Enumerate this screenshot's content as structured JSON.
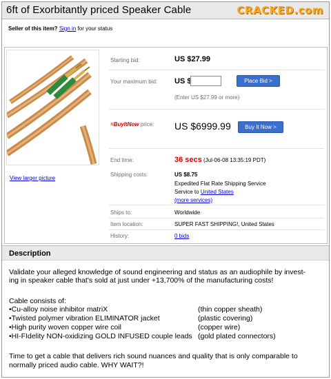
{
  "header": {
    "title": "6ft of Exorbitantly priced Speaker Cable",
    "logo": "CRACKED.com"
  },
  "seller": {
    "question": "Seller of this item?",
    "sign_in": "Sign in",
    "suffix": "for your status"
  },
  "listing": {
    "starting_bid_label": "Starting bid:",
    "starting_bid_value": "US $27.99",
    "max_bid_label": "Your maximum bid:",
    "max_bid_currency": "US $",
    "max_bid_value": "",
    "place_bid_button": "Place Bid >",
    "enter_hint": "(Enter US $27.99 or more)",
    "buy_it_now_logo": "=BuyItNow",
    "buy_it_now_label": "price:",
    "buy_it_now_price": "US $6999.99",
    "buy_it_now_button": "Buy It Now >",
    "end_time_label": "End time:",
    "end_time_secs": "36 secs",
    "end_time_date": "(Jul-06-08 13:35:19 PDT)",
    "shipping_label": "Shipping costs:",
    "shipping_value": "US $8.75",
    "shipping_service": "Expedited Flat Rate Shipping Service",
    "shipping_to_prefix": "Service to",
    "shipping_to_link": "United States",
    "more_services": "(more services)",
    "ships_to_label": "Ships to:",
    "ships_to_value": "Worldwide",
    "location_label": "Item location:",
    "location_value": "SUPER FAST SHIPPING!, United States",
    "history_label": "History:",
    "history_value": "0 bids",
    "view_larger": "View larger picture"
  },
  "description": {
    "heading": "Description",
    "intro_line1": "Validate your alleged knowledge of sound engineering and status as an audiophile by invest-",
    "intro_line2": "ing in speaker cable that's sold at just under +13,700% of the manufacturing costs!",
    "consists": "Cable consists of:",
    "items": [
      {
        "left": "•Cu-alloy noise inhibitor matriX",
        "right": "(thin copper sheath)"
      },
      {
        "left": "•Twisted polymer vibration ELIMINATOR jacket",
        "right": "(plastic covering)"
      },
      {
        "left": "•High purity woven copper wire coil",
        "right": "(copper wire)"
      },
      {
        "left": "•HI-FIdelity NON-oxidizing GOLD INFUSED couple leads",
        "right": "(gold plated connectors)"
      }
    ],
    "outro_line1": "Time to get a cable that delivers rich sound nuances and quality that is only comparable to",
    "outro_line2": "normally priced audio cable. WHY WAIT?!"
  },
  "colors": {
    "accent_button": "#3a6fd0",
    "link": "#0000cc",
    "alert_red": "#e00000",
    "logo": "#f5a623"
  }
}
